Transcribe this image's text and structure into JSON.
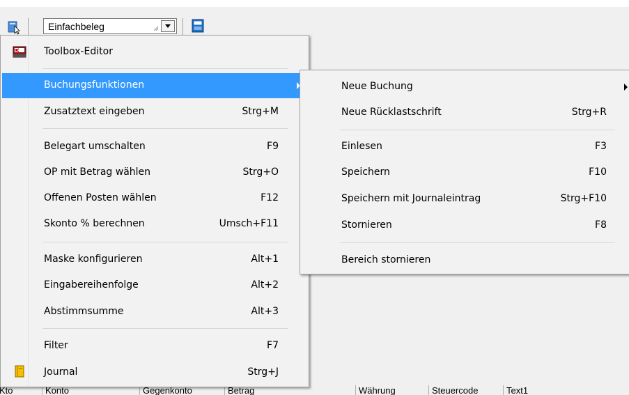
{
  "toolbar": {
    "doc_icon": "document-cursor-icon",
    "combo_value": "Einfachbeleg",
    "calc_icon": "calculator-icon"
  },
  "main_menu": {
    "items": [
      {
        "label": "Toolbox-Editor",
        "shortcut": "",
        "icon": "toolbox-editor-icon"
      },
      {
        "label": "Buchungsfunktionen",
        "shortcut": "",
        "submenu": true,
        "highlighted": true
      },
      {
        "label": "Zusatztext eingeben",
        "shortcut": "Strg+M"
      },
      {
        "label": "Belegart umschalten",
        "shortcut": "F9"
      },
      {
        "label": "OP mit Betrag wählen",
        "shortcut": "Strg+O"
      },
      {
        "label": "Offenen Posten wählen",
        "shortcut": "F12"
      },
      {
        "label": "Skonto % berechnen",
        "shortcut": "Umsch+F11"
      },
      {
        "label": "Maske konfigurieren",
        "shortcut": "Alt+1"
      },
      {
        "label": "Eingabereihenfolge",
        "shortcut": "Alt+2"
      },
      {
        "label": "Abstimmsumme",
        "shortcut": "Alt+3"
      },
      {
        "label": "Filter",
        "shortcut": "F7"
      },
      {
        "label": "Journal",
        "shortcut": "Strg+J",
        "icon": "journal-icon"
      }
    ]
  },
  "sub_menu": {
    "items": [
      {
        "label": "Neue Buchung",
        "shortcut": "",
        "submenu": true
      },
      {
        "label": "Neue Rücklastschrift",
        "shortcut": "Strg+R"
      },
      {
        "label": "Einlesen",
        "shortcut": "F3"
      },
      {
        "label": "Speichern",
        "shortcut": "F10"
      },
      {
        "label": "Speichern mit Journaleintrag",
        "shortcut": "Strg+F10"
      },
      {
        "label": "Stornieren",
        "shortcut": "F8"
      },
      {
        "label": "Bereich stornieren",
        "shortcut": ""
      }
    ]
  },
  "grid_headers": [
    "Kto",
    "Konto",
    "Gegenkonto",
    "Betrag",
    "Währung",
    "Steuercode",
    "Text1"
  ],
  "colors": {
    "highlight": "#3399ff",
    "menu_bg": "#f2f2f2",
    "toolbar_bg": "#f0f0f0"
  }
}
